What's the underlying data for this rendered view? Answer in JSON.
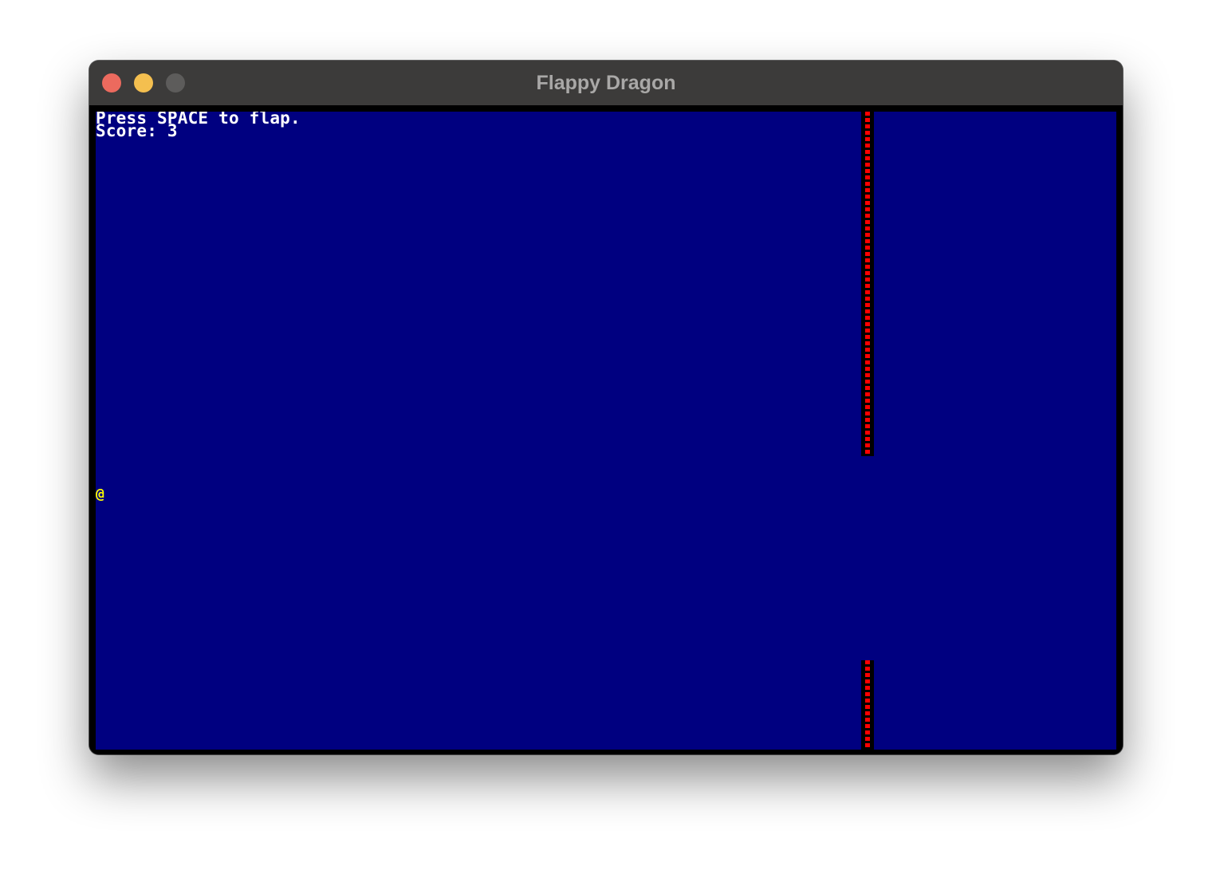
{
  "window": {
    "title": "Flappy Dragon",
    "controls": [
      "close",
      "minimize",
      "zoom"
    ]
  },
  "game": {
    "instructions": "Press SPACE to flap.",
    "score_text": "Score: 3",
    "player_glyph": "@",
    "colors": {
      "background": "#000080",
      "text": "#ffffff",
      "player": "#ffff00",
      "obstacle": "#ff0000"
    },
    "obstacle_glyph": "|"
  }
}
